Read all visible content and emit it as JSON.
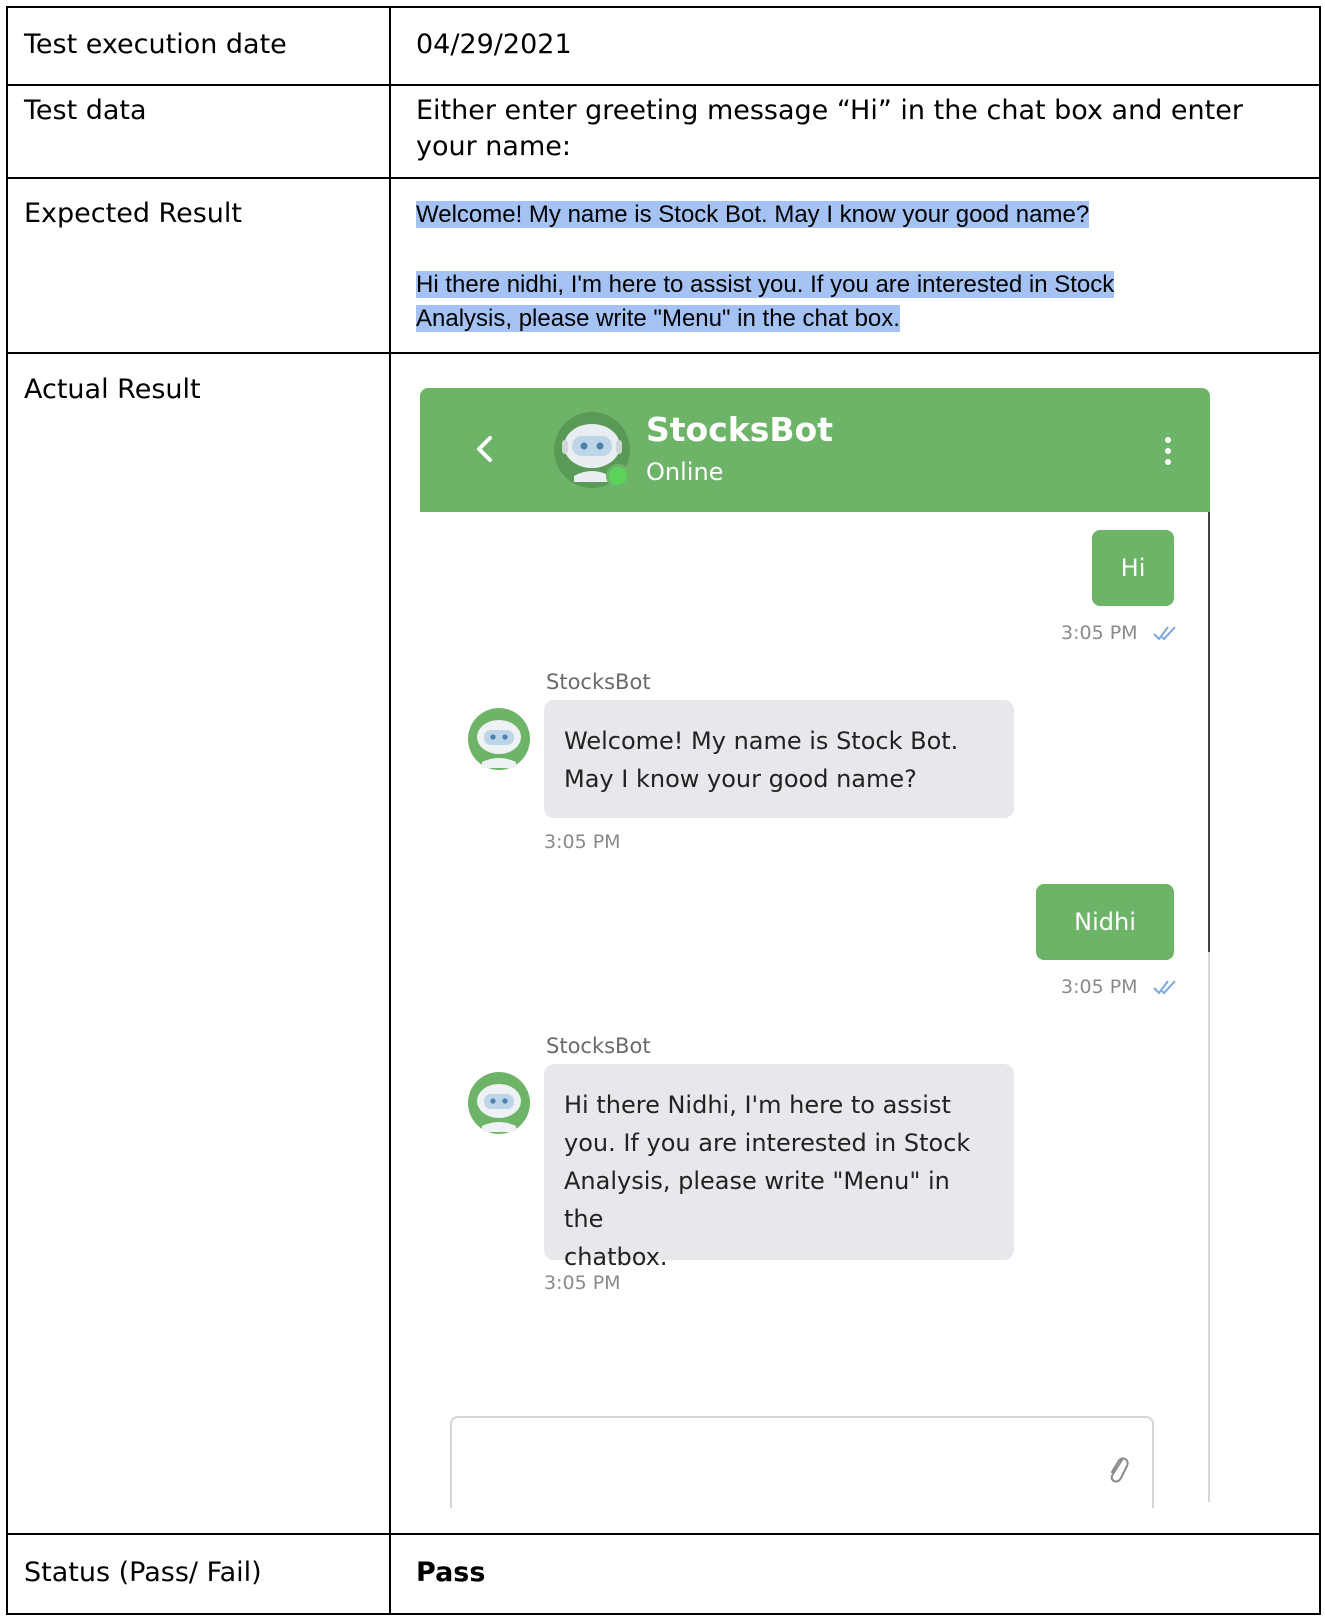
{
  "rows": {
    "date_label": "Test execution date",
    "date_value": "04/29/2021",
    "data_label": "Test data",
    "data_value_line1": "Either enter greeting message “Hi” in the chat box and enter",
    "data_value_line2": "your name:",
    "expected_label": "Expected Result",
    "expected_line1": "Welcome! My name is Stock Bot. May I know your good name?",
    "expected_line2": "Hi there nidhi, I'm here to assist you. If you are interested in Stock",
    "expected_line3": "Analysis, please write \"Menu\" in the chat box.",
    "actual_label": "Actual Result",
    "status_label": "Status (Pass/ Fail)",
    "status_value": "Pass"
  },
  "chat": {
    "header": {
      "name": "StocksBot",
      "status": "Online",
      "icons": [
        "back-arrow-icon",
        "bot-avatar-icon",
        "more-vertical-icon"
      ]
    },
    "messages": [
      {
        "from": "user",
        "text": "Hi",
        "time": "3:05 PM"
      },
      {
        "from": "bot",
        "sender": "StocksBot",
        "line1": "Welcome! My name is Stock Bot.",
        "line2": "May I know your good name?",
        "time": "3:05 PM"
      },
      {
        "from": "user",
        "text": "Nidhi",
        "time": "3:05 PM"
      },
      {
        "from": "bot",
        "sender": "StocksBot",
        "line1": "Hi there Nidhi, I'm here to assist",
        "line2": "you. If you are interested in Stock",
        "line3": "Analysis, please write \"Menu\" in the",
        "line4": "chatbox.",
        "time": "3:05 PM"
      }
    ],
    "composer": {
      "icon": "paperclip-icon"
    },
    "colors": {
      "header": "#6db469",
      "user_bubble": "#6db469",
      "bot_bubble": "#e8e8ec",
      "online": "#5bd35b",
      "read_ticks": "#7aa7e0"
    }
  }
}
